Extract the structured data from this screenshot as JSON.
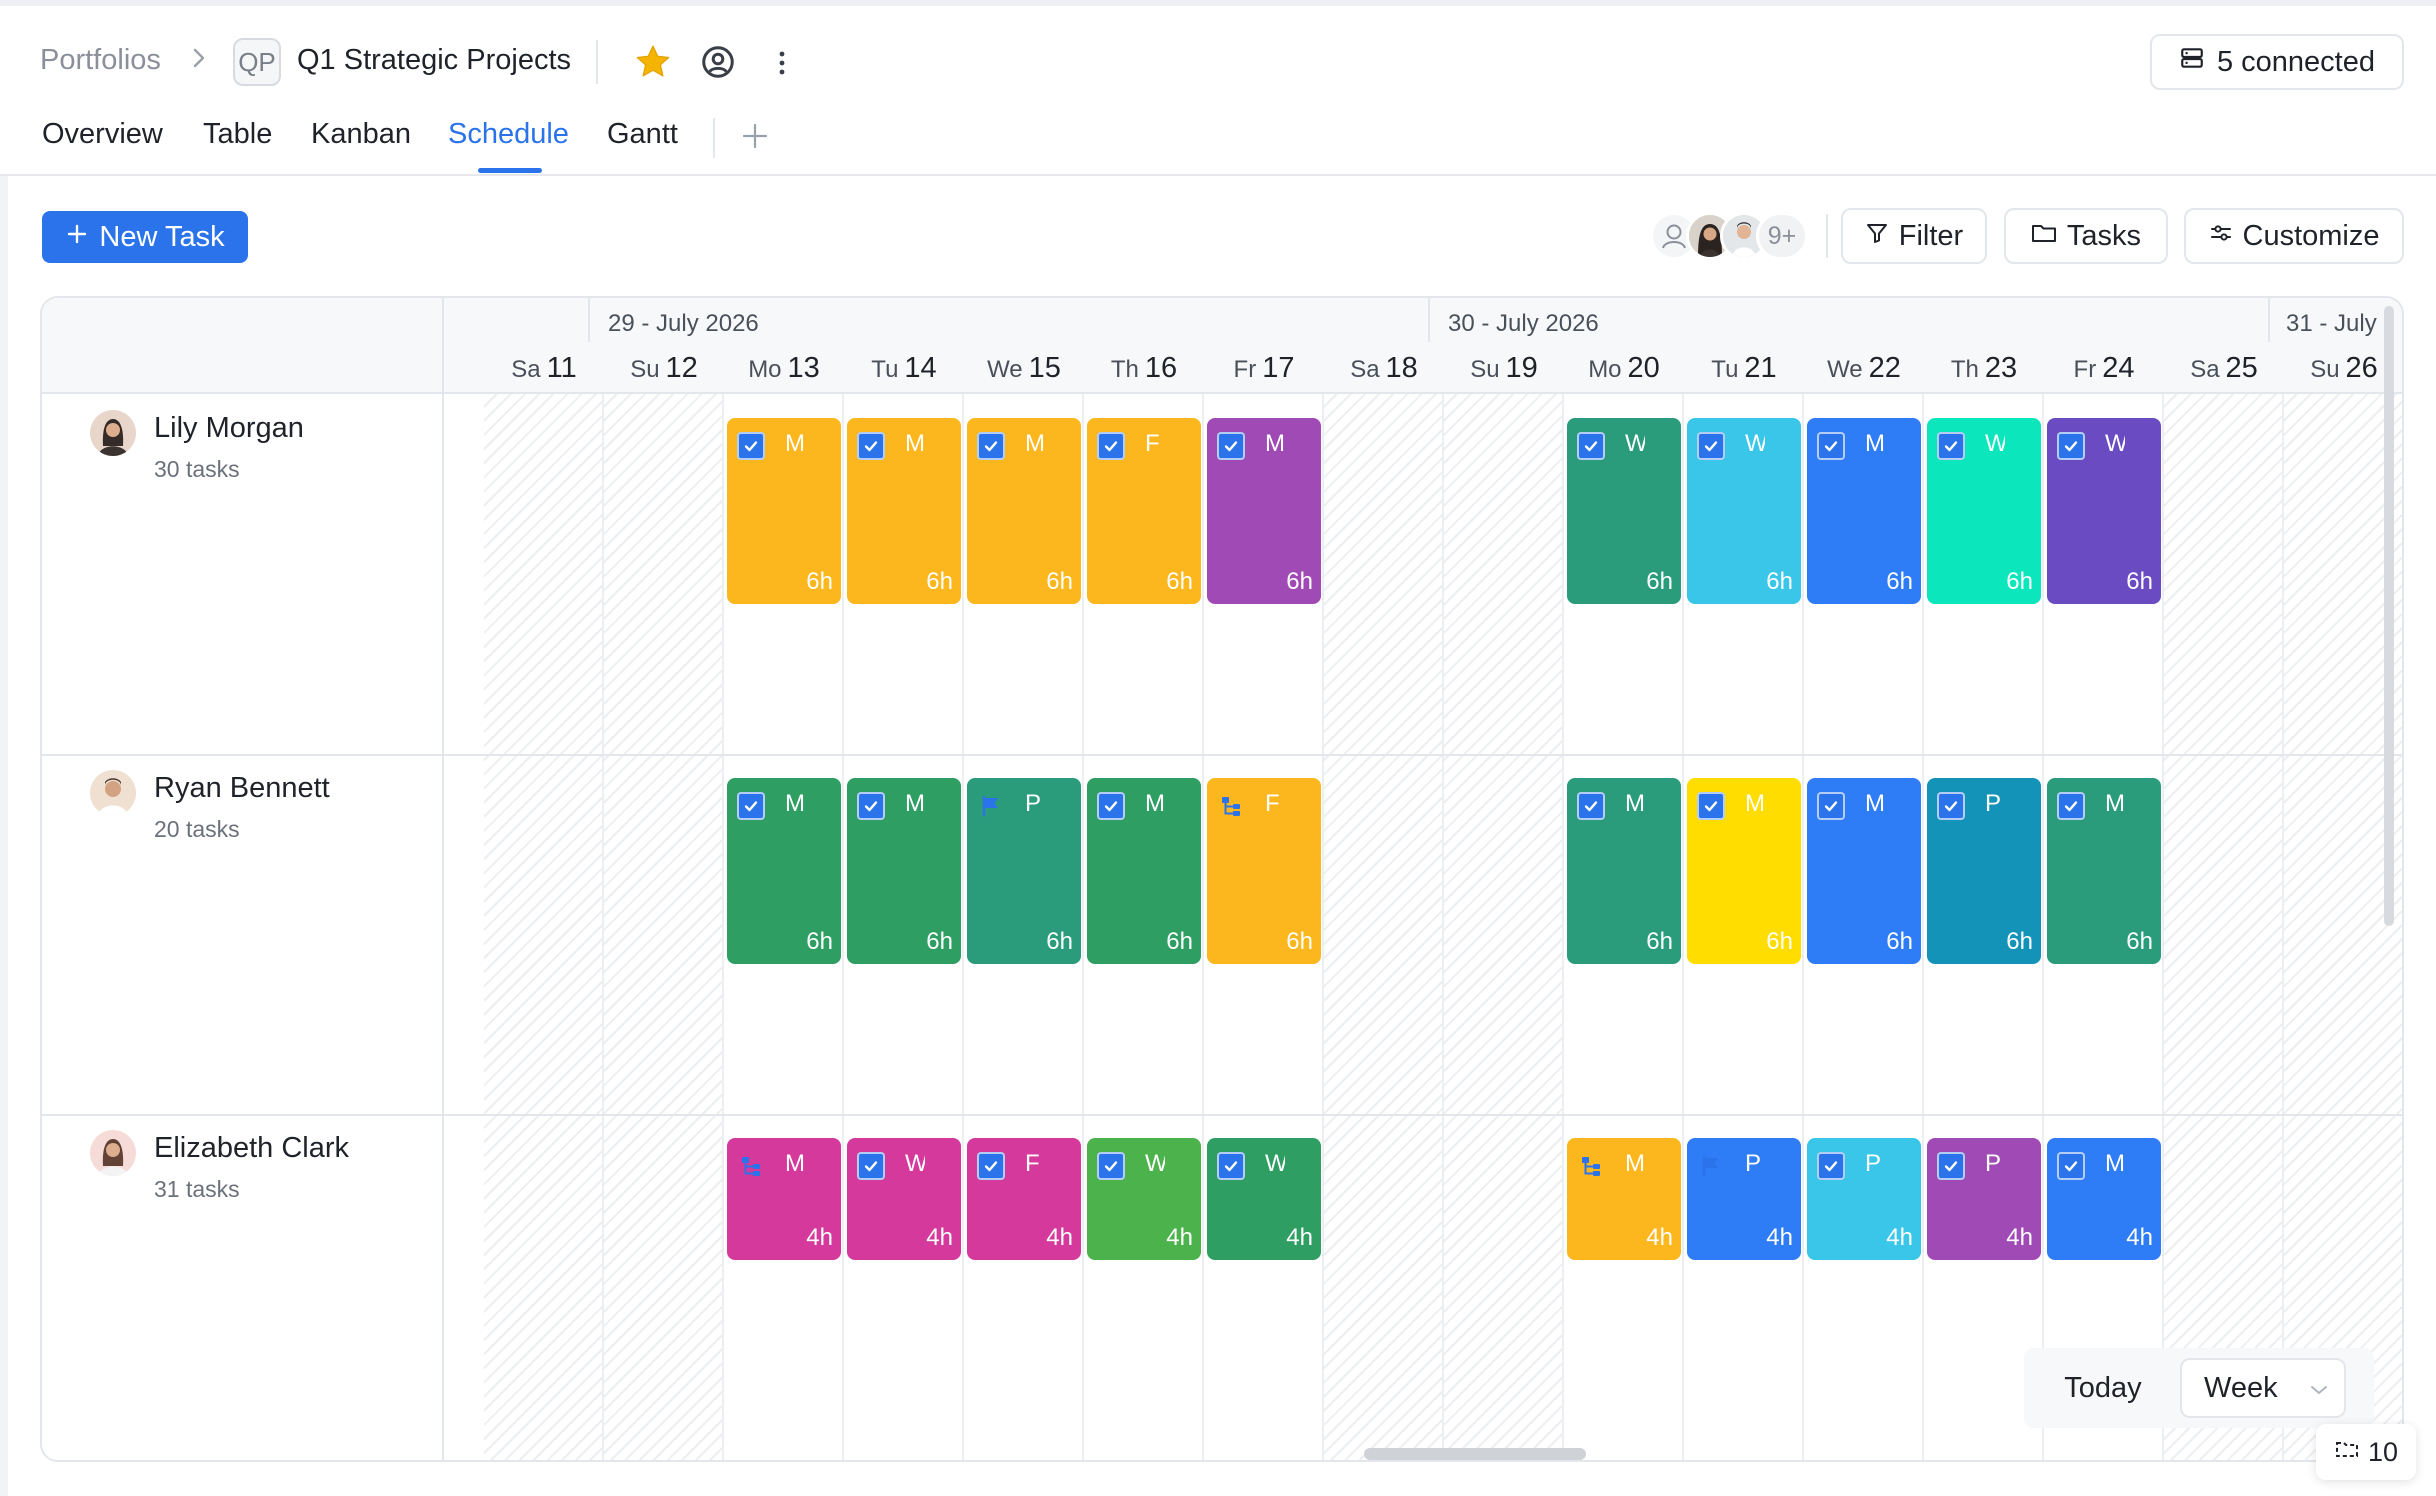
{
  "header": {
    "breadcrumb_root": "Portfolios",
    "project_badge": "QP",
    "project_title": "Q1 Strategic Projects",
    "connected_label": "5 connected"
  },
  "tabs": [
    {
      "label": "Overview",
      "active": false
    },
    {
      "label": "Table",
      "active": false
    },
    {
      "label": "Kanban",
      "active": false
    },
    {
      "label": "Schedule",
      "active": true
    },
    {
      "label": "Gantt",
      "active": false
    }
  ],
  "toolbar": {
    "new_task_label": "New Task",
    "avatars_more": "9+",
    "filter_label": "Filter",
    "tasks_label": "Tasks",
    "customize_label": "Customize"
  },
  "schedule": {
    "weeks": [
      "29 - July 2026",
      "30 - July 2026",
      "31 - July"
    ],
    "days": [
      {
        "dow": "Sa",
        "num": "11",
        "weekend": true
      },
      {
        "dow": "Su",
        "num": "12",
        "weekend": true
      },
      {
        "dow": "Mo",
        "num": "13",
        "weekend": false
      },
      {
        "dow": "Tu",
        "num": "14",
        "weekend": false
      },
      {
        "dow": "We",
        "num": "15",
        "weekend": false
      },
      {
        "dow": "Th",
        "num": "16",
        "weekend": false
      },
      {
        "dow": "Fr",
        "num": "17",
        "weekend": false
      },
      {
        "dow": "Sa",
        "num": "18",
        "weekend": true
      },
      {
        "dow": "Su",
        "num": "19",
        "weekend": true
      },
      {
        "dow": "Mo",
        "num": "20",
        "weekend": false
      },
      {
        "dow": "Tu",
        "num": "21",
        "weekend": false
      },
      {
        "dow": "We",
        "num": "22",
        "weekend": false
      },
      {
        "dow": "Th",
        "num": "23",
        "weekend": false
      },
      {
        "dow": "Fr",
        "num": "24",
        "weekend": false
      },
      {
        "dow": "Sa",
        "num": "25",
        "weekend": true
      },
      {
        "dow": "Su",
        "num": "26",
        "weekend": true
      }
    ],
    "people": [
      {
        "name": "Lily Morgan",
        "tasks": "30 tasks",
        "cards": [
          {
            "day": 2,
            "title": "M",
            "hours": "6h",
            "color": "#FDB71E",
            "icon": "check"
          },
          {
            "day": 3,
            "title": "M",
            "hours": "6h",
            "color": "#FDB71E",
            "icon": "check"
          },
          {
            "day": 4,
            "title": "M",
            "hours": "6h",
            "color": "#FDB71E",
            "icon": "check"
          },
          {
            "day": 5,
            "title": "F",
            "hours": "6h",
            "color": "#FDB71E",
            "icon": "check"
          },
          {
            "day": 6,
            "title": "M",
            "hours": "6h",
            "color": "#A04BB5",
            "icon": "check"
          },
          {
            "day": 9,
            "title": "W",
            "hours": "6h",
            "color": "#2A9C7C",
            "icon": "check"
          },
          {
            "day": 10,
            "title": "W",
            "hours": "6h",
            "color": "#3AC6E9",
            "icon": "check"
          },
          {
            "day": 11,
            "title": "M",
            "hours": "6h",
            "color": "#2E7CF6",
            "icon": "check"
          },
          {
            "day": 12,
            "title": "W",
            "hours": "6h",
            "color": "#0BE6BD",
            "icon": "check"
          },
          {
            "day": 13,
            "title": "W",
            "hours": "6h",
            "color": "#6A4BC2",
            "icon": "check"
          }
        ]
      },
      {
        "name": "Ryan Bennett",
        "tasks": "20 tasks",
        "cards": [
          {
            "day": 2,
            "title": "M",
            "hours": "6h",
            "color": "#2E9E63",
            "icon": "check"
          },
          {
            "day": 3,
            "title": "M",
            "hours": "6h",
            "color": "#2E9E63",
            "icon": "check"
          },
          {
            "day": 4,
            "title": "P",
            "hours": "6h",
            "color": "#2A9C7C",
            "icon": "flag"
          },
          {
            "day": 5,
            "title": "M",
            "hours": "6h",
            "color": "#2E9E63",
            "icon": "check"
          },
          {
            "day": 6,
            "title": "F",
            "hours": "6h",
            "color": "#FDB71E",
            "icon": "tree"
          },
          {
            "day": 9,
            "title": "M",
            "hours": "6h",
            "color": "#2A9C7C",
            "icon": "check"
          },
          {
            "day": 10,
            "title": "M",
            "hours": "6h",
            "color": "#FFDD00",
            "icon": "check"
          },
          {
            "day": 11,
            "title": "M",
            "hours": "6h",
            "color": "#2E7CF6",
            "icon": "check"
          },
          {
            "day": 12,
            "title": "P",
            "hours": "6h",
            "color": "#1493B8",
            "icon": "check"
          },
          {
            "day": 13,
            "title": "M",
            "hours": "6h",
            "color": "#2A9C7C",
            "icon": "check"
          }
        ]
      },
      {
        "name": "Elizabeth Clark",
        "tasks": "31 tasks",
        "cards": [
          {
            "day": 2,
            "title": "M",
            "hours": "4h",
            "color": "#D6399C",
            "icon": "tree"
          },
          {
            "day": 3,
            "title": "W",
            "hours": "4h",
            "color": "#D6399C",
            "icon": "check"
          },
          {
            "day": 4,
            "title": "F",
            "hours": "4h",
            "color": "#D6399C",
            "icon": "check"
          },
          {
            "day": 5,
            "title": "W",
            "hours": "4h",
            "color": "#4CB34C",
            "icon": "check"
          },
          {
            "day": 6,
            "title": "W",
            "hours": "4h",
            "color": "#2E9E63",
            "icon": "check"
          },
          {
            "day": 9,
            "title": "M",
            "hours": "4h",
            "color": "#FDB71E",
            "icon": "tree"
          },
          {
            "day": 10,
            "title": "P",
            "hours": "4h",
            "color": "#2E7CF6",
            "icon": "flag"
          },
          {
            "day": 11,
            "title": "P",
            "hours": "4h",
            "color": "#3AC6E9",
            "icon": "check"
          },
          {
            "day": 12,
            "title": "P",
            "hours": "4h",
            "color": "#A04BB5",
            "icon": "check"
          },
          {
            "day": 13,
            "title": "M",
            "hours": "4h",
            "color": "#2E7CF6",
            "icon": "check"
          }
        ]
      }
    ]
  },
  "footer": {
    "today_label": "Today",
    "view_select": "Week",
    "page_count": "10"
  }
}
